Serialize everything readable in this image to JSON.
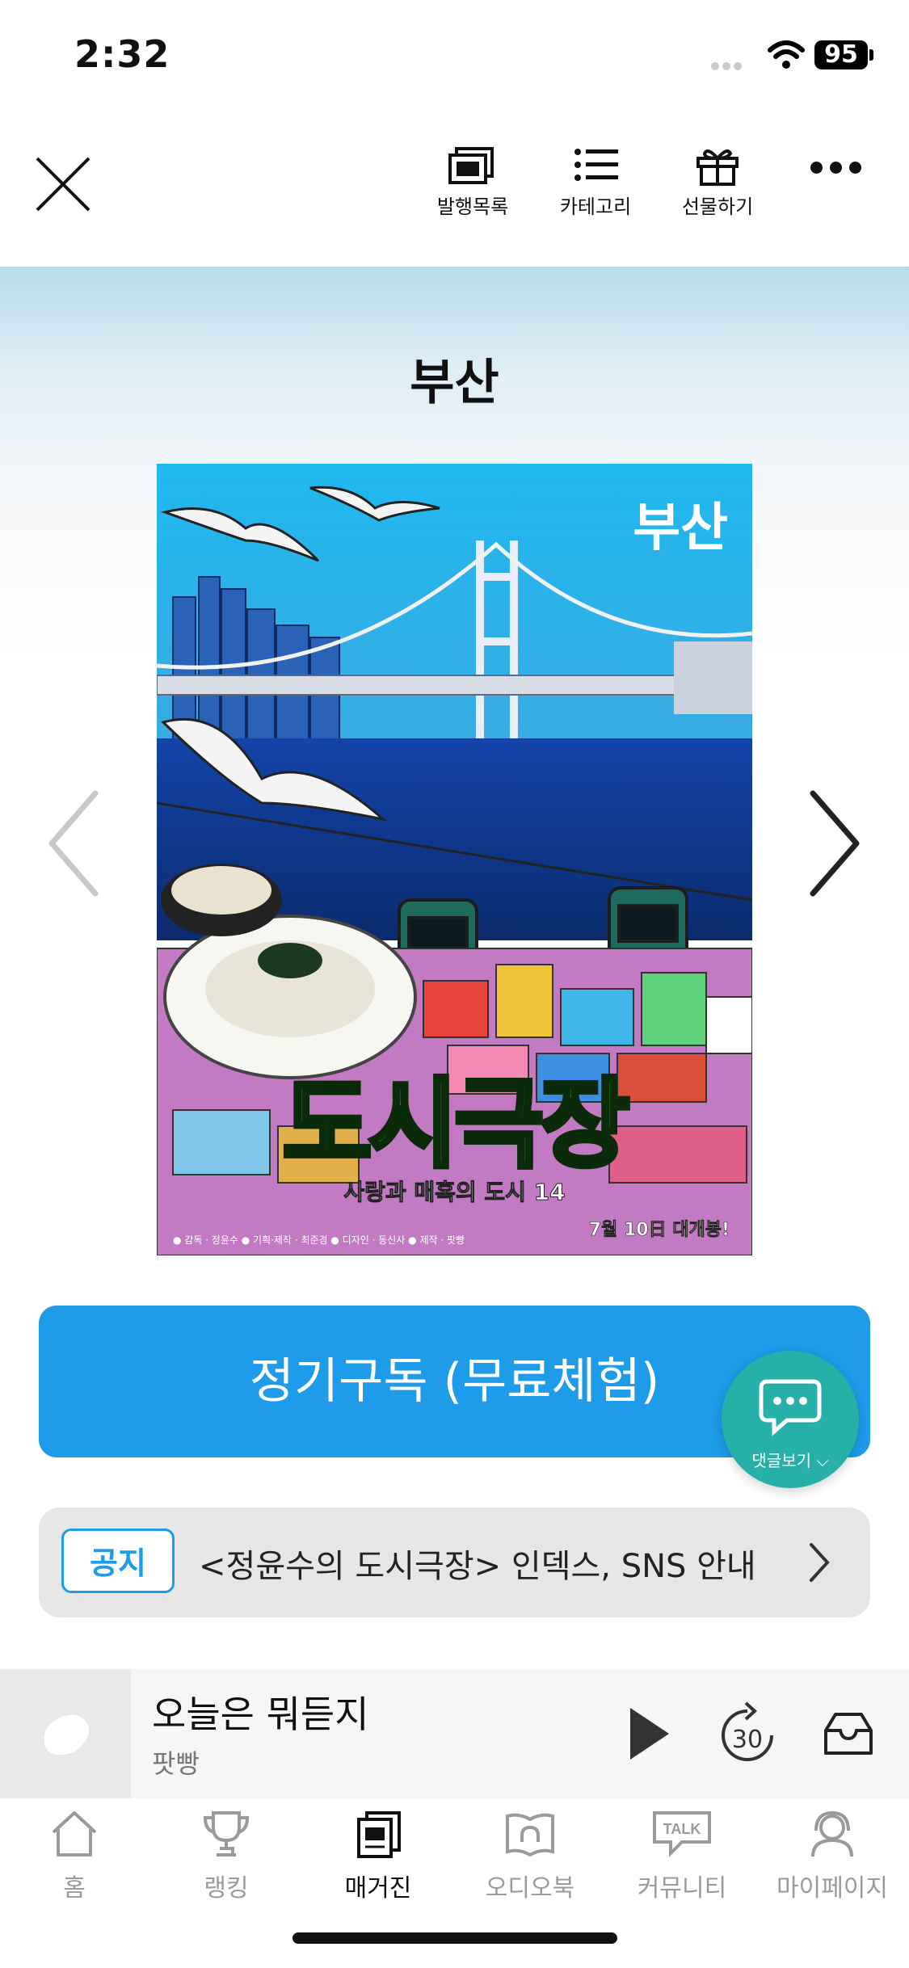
{
  "status": {
    "time": "2:32",
    "battery": "95"
  },
  "toolbar": {
    "items": [
      {
        "label": "발행목록",
        "icon": "issue-list-icon"
      },
      {
        "label": "카테고리",
        "icon": "category-list-icon"
      },
      {
        "label": "선물하기",
        "icon": "gift-icon"
      }
    ]
  },
  "magazine": {
    "title": "부산",
    "cover": {
      "badge": "부산",
      "main_title": "도시극장",
      "subtitle": "사랑과 매혹의 도시 14",
      "release": "7월 10日 대개봉!",
      "credits": "● 감독 · 정윤수   ● 기획·제작 · 최준경   ● 디자인 · 동신사   ● 제작 · 팟빵"
    }
  },
  "subscribe": {
    "label": "정기구독 (무료체험)"
  },
  "comments": {
    "label": "댓글보기"
  },
  "notice": {
    "tag": "공지",
    "text": "<정윤수의 도시극장> 인덱스, SNS 안내"
  },
  "player": {
    "title": "오늘은 뭐듣지",
    "subtitle": "팟빵",
    "skip_seconds": "30"
  },
  "tabs": [
    {
      "label": "홈",
      "icon": "home-icon",
      "active": false
    },
    {
      "label": "랭킹",
      "icon": "trophy-icon",
      "active": false
    },
    {
      "label": "매거진",
      "icon": "magazine-icon",
      "active": true
    },
    {
      "label": "오디오북",
      "icon": "audiobook-icon",
      "active": false
    },
    {
      "label": "커뮤니티",
      "icon": "talk-icon",
      "active": false,
      "icon_text": "TALK"
    },
    {
      "label": "마이페이지",
      "icon": "profile-icon",
      "active": false
    }
  ],
  "colors": {
    "accent": "#1e9be9",
    "fab": "#26b0a8",
    "cover_title": "#39e639"
  }
}
